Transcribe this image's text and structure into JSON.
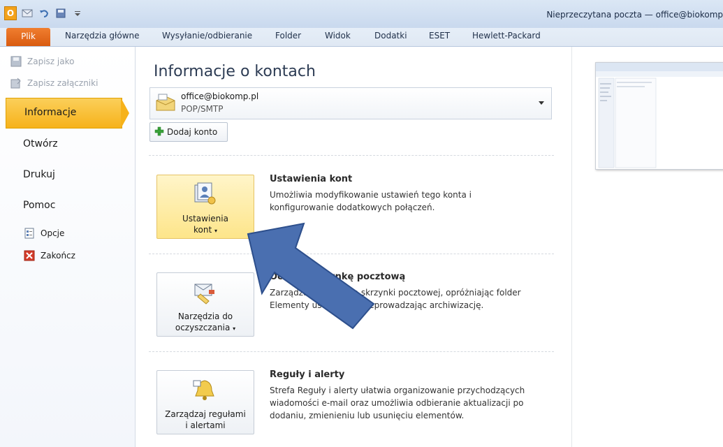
{
  "window": {
    "title": "Nieprzeczytana poczta — office@biokomp"
  },
  "ribbon": {
    "file_tab": "Plik",
    "tabs": [
      "Narzędzia główne",
      "Wysyłanie/odbieranie",
      "Folder",
      "Widok",
      "Dodatki",
      "ESET",
      "Hewlett-Packard"
    ]
  },
  "nav": {
    "save_as": "Zapisz jako",
    "save_attachments": "Zapisz załączniki",
    "info": "Informacje",
    "open": "Otwórz",
    "print": "Drukuj",
    "help": "Pomoc",
    "options": "Opcje",
    "exit": "Zakończ"
  },
  "main": {
    "title": "Informacje o kontach",
    "account_email": "office@biokomp.pl",
    "account_type": "POP/SMTP",
    "add_account": "Dodaj konto",
    "sections": [
      {
        "button_label_1": "Ustawienia",
        "button_label_2": "kont",
        "title": "Ustawienia kont",
        "desc_1": "Umożliwia modyfikowanie ustawień tego konta i",
        "desc_2": "konfigurowanie dodatkowych połączeń."
      },
      {
        "button_label_1": "Narzędzia do",
        "button_label_2": "oczyszczania",
        "title": "Oczyść skrzynkę pocztową",
        "desc_1": "Zarządzaj rozmiarem skrzynki pocztowej, opróżniając folder",
        "desc_2": "Elementy usunięte i przeprowadzając archiwizację."
      },
      {
        "button_label_1": "Zarządzaj regułami",
        "button_label_2": "i alertami",
        "title": "Reguły i alerty",
        "desc_1": "Strefa Reguły i alerty ułatwia organizowanie przychodzących",
        "desc_2": "wiadomości e-mail oraz umożliwia odbieranie aktualizacji po",
        "desc_3": "dodaniu, zmienieniu lub usunięciu elementów."
      }
    ]
  },
  "colors": {
    "file_tab": "#e2661a",
    "active_nav": "#f6b21a",
    "overlay_arrow": "#4a6fb0"
  },
  "icons": [
    "outlook-icon",
    "save-icon",
    "undo-icon",
    "send-receive-icon",
    "account-box-icon",
    "green-plus-icon",
    "account-settings-icon",
    "cleanup-tools-icon",
    "rules-alerts-icon",
    "options-icon",
    "exit-icon",
    "dropdown-arrow-icon"
  ]
}
